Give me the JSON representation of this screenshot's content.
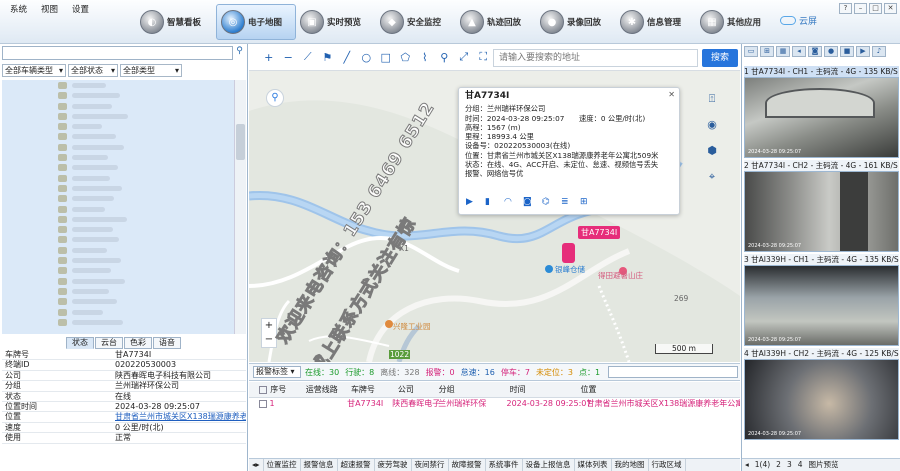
{
  "menu": [
    "系统",
    "视图",
    "设置"
  ],
  "nav_tabs": [
    {
      "label": "智慧看板",
      "icon": "dashboard-icon"
    },
    {
      "label": "电子地图",
      "icon": "globe-icon"
    },
    {
      "label": "实时预览",
      "icon": "camera-icon"
    },
    {
      "label": "安全监控",
      "icon": "shield-icon"
    },
    {
      "label": "轨迹回放",
      "icon": "car-icon"
    },
    {
      "label": "录像回放",
      "icon": "record-icon"
    },
    {
      "label": "信息管理",
      "icon": "gear-icon"
    },
    {
      "label": "其他应用",
      "icon": "apps-icon"
    }
  ],
  "cloud_label": "云屏",
  "filters": [
    "全部车辆类型",
    "全部状态",
    "全部类型"
  ],
  "left_tabs": [
    "状态",
    "云台",
    "色彩",
    "语音"
  ],
  "info_rows": [
    {
      "k": "车牌号",
      "v": "甘A7734I"
    },
    {
      "k": "终端ID",
      "v": "020220530003"
    },
    {
      "k": "公司",
      "v": "陕西春晖电子科技有限公司"
    },
    {
      "k": "分组",
      "v": "兰州瑞祥环保公司"
    },
    {
      "k": "状态",
      "v": "在线"
    },
    {
      "k": "位置时间",
      "v": "2024-03-28 09:25:07"
    },
    {
      "k": "位置",
      "v": "甘肃省兰州市城关区X138瑞源康养老"
    },
    {
      "k": "速度",
      "v": "0 公里/时(北)"
    },
    {
      "k": "使用",
      "v": "正常"
    }
  ],
  "map": {
    "search_placeholder": "请输入要搜索的地址",
    "search_button": "搜索",
    "scale": "500 m",
    "vehicle_label": "甘A7734I",
    "pois": [
      "银峰仓储",
      "得田避暑山庄",
      "兴隆工业园"
    ],
    "road_labels": [
      "X1",
      "269",
      "1022"
    ]
  },
  "popup": {
    "title": "甘A7734I",
    "lines": [
      "分组：兰州瑞祥环保公司",
      "时间：2024-03-28 09:25:07　　速度：0 公里/时(北)",
      "高程：1567 (m)",
      "里程：18993.4 公里",
      "设备号：020220530003(在线)",
      "位置：甘肃省兰州市城关区X138瑞源康养老年公寓北509米",
      "状态：在线、4G、ACC开启、未定位、怠速、视频信号丢失",
      "报警、网络信号优"
    ]
  },
  "alarm": {
    "select": "报警标签",
    "stats": [
      {
        "text": "在线：30",
        "color": "#1a9a2a"
      },
      {
        "text": "行驶：8",
        "color": "#1a9a2a"
      },
      {
        "text": "离线：328",
        "color": "#777777"
      },
      {
        "text": "报警：0",
        "color": "#d4237a"
      },
      {
        "text": "怠速：16",
        "color": "#2060b0"
      },
      {
        "text": "停车：7",
        "color": "#d4237a"
      },
      {
        "text": "未定位：3",
        "color": "#d48a00"
      },
      {
        "text": "点：1",
        "color": "#1a9a2a"
      }
    ]
  },
  "table": {
    "headers": [
      "序号",
      "运营线路",
      "车牌号",
      "公司",
      "分组",
      "时间",
      "位置"
    ],
    "row": [
      "1",
      "",
      "甘A7734I",
      "陕西春晖电子",
      "兰州瑞祥环保",
      "2024-03-28 09:25:07",
      "甘肃省兰州市城关区X138瑞源康养老年公寓北509米"
    ]
  },
  "bottom_tabs": [
    "位置监控",
    "报警信息",
    "超速报警",
    "疲劳驾驶",
    "夜间禁行",
    "故障报警",
    "系统事件",
    "设备上报信息",
    "媒体列表",
    "我的地图",
    "行政区域"
  ],
  "video_channels": [
    "1 甘A7734I - CH1 - 主码流 - 4G - 135 KB/S / 8",
    "2 甘A7734I - CH2 - 主码流 - 4G - 161 KB/S / 8",
    "3 甘AI339H - CH1 - 主码流 - 4G - 135 KB/S / 8",
    "4 甘AI339H - CH2 - 主码流 - 4G - 125 KB/S / 8"
  ],
  "video_timestamps": [
    "2024-03-28 09:25:07",
    "2024-03-28 09:25:07",
    "2024-03-28 09:25:07",
    "2024-03-28 09:25:07"
  ],
  "video_pages": [
    "1(4)",
    "2",
    "3",
    "4",
    "图片预览"
  ],
  "watermark": [
    "欢迎来电咨询：153 6469 6512",
    "或上联系方式关注有惊"
  ]
}
